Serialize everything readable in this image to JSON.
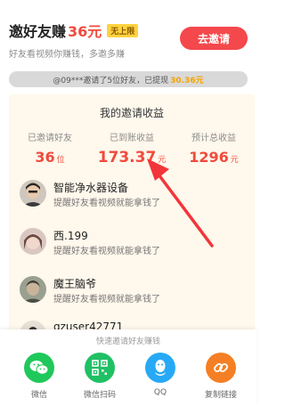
{
  "header": {
    "title": "邀好友赚",
    "amount": "36元",
    "badge": "无上限",
    "subtitle": "好友看视频你赚钱，多邀多赚",
    "invite_button": "去邀请"
  },
  "notice": {
    "text": "@09***邀请了5位好友，已提现",
    "amount": "30.36元"
  },
  "earnings": {
    "title": "我的邀请收益",
    "stats": [
      {
        "label": "已邀请好友",
        "value": "36",
        "unit": "位"
      },
      {
        "label": "已到账收益",
        "value": "173.37",
        "unit": "元"
      },
      {
        "label": "预计总收益",
        "value": "1296",
        "unit": "元"
      }
    ]
  },
  "friends": [
    {
      "name": "智能净水器设备",
      "hint": "提醒好友看视频就能拿钱了"
    },
    {
      "name": "西.199",
      "hint": "提醒好友看视频就能拿钱了"
    },
    {
      "name": "魔王脑爷",
      "hint": "提醒好友看视频就能拿钱了"
    },
    {
      "name": "qzuser42771",
      "hint": ""
    }
  ],
  "share": {
    "title": "快速邀请好友赚钱",
    "items": [
      {
        "label": "微信",
        "icon": "wechat-icon",
        "color": "#1fc85a"
      },
      {
        "label": "微信扫码",
        "icon": "qr-code-icon",
        "color": "#20c064"
      },
      {
        "label": "QQ",
        "icon": "qq-icon",
        "color": "#27a9f5"
      },
      {
        "label": "复制链接",
        "icon": "link-icon",
        "color": "#f57f24"
      }
    ]
  },
  "colors": {
    "accent_red": "#f04a3e",
    "card_bg": "#fff8ec",
    "arrow": "#f2353a"
  }
}
